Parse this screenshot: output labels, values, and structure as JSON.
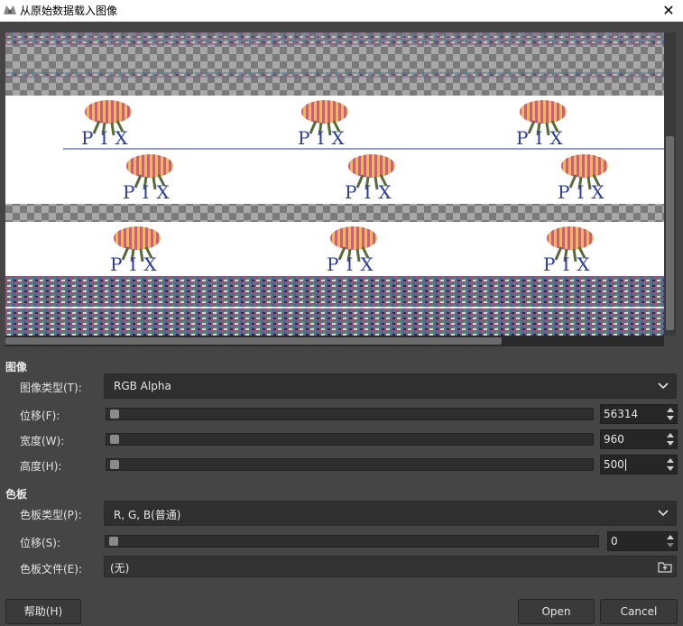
{
  "window": {
    "title": "从原始数据载入图像",
    "close_glyph": "✕"
  },
  "image_section": {
    "heading": "图像",
    "type_label": "图像类型(T):",
    "type_value": "RGB Alpha",
    "offset_label": "位移(F):",
    "offset_value": "56314",
    "width_label": "宽度(W):",
    "width_value": "960",
    "height_label": "高度(H):",
    "height_value": "500"
  },
  "palette_section": {
    "heading": "色板",
    "type_label": "色板类型(P):",
    "type_value": "R, G, B(普通)",
    "offset_label": "位移(S):",
    "offset_value": "0",
    "file_label": "色板文件(E):",
    "file_value": "(无)"
  },
  "buttons": {
    "help": "帮助(H)",
    "open": "Open",
    "cancel": "Cancel"
  },
  "preview": {
    "tile_text": "PIX",
    "colors": {
      "checker_light": "#a8a8a8",
      "checker_dark": "#7a7a7a",
      "white_band": "#ffffff",
      "text_blue": "#2a3c9c"
    }
  },
  "icons": {
    "app": "gimp-icon",
    "chevron": "chevron-down-icon",
    "file": "open-file-icon"
  }
}
